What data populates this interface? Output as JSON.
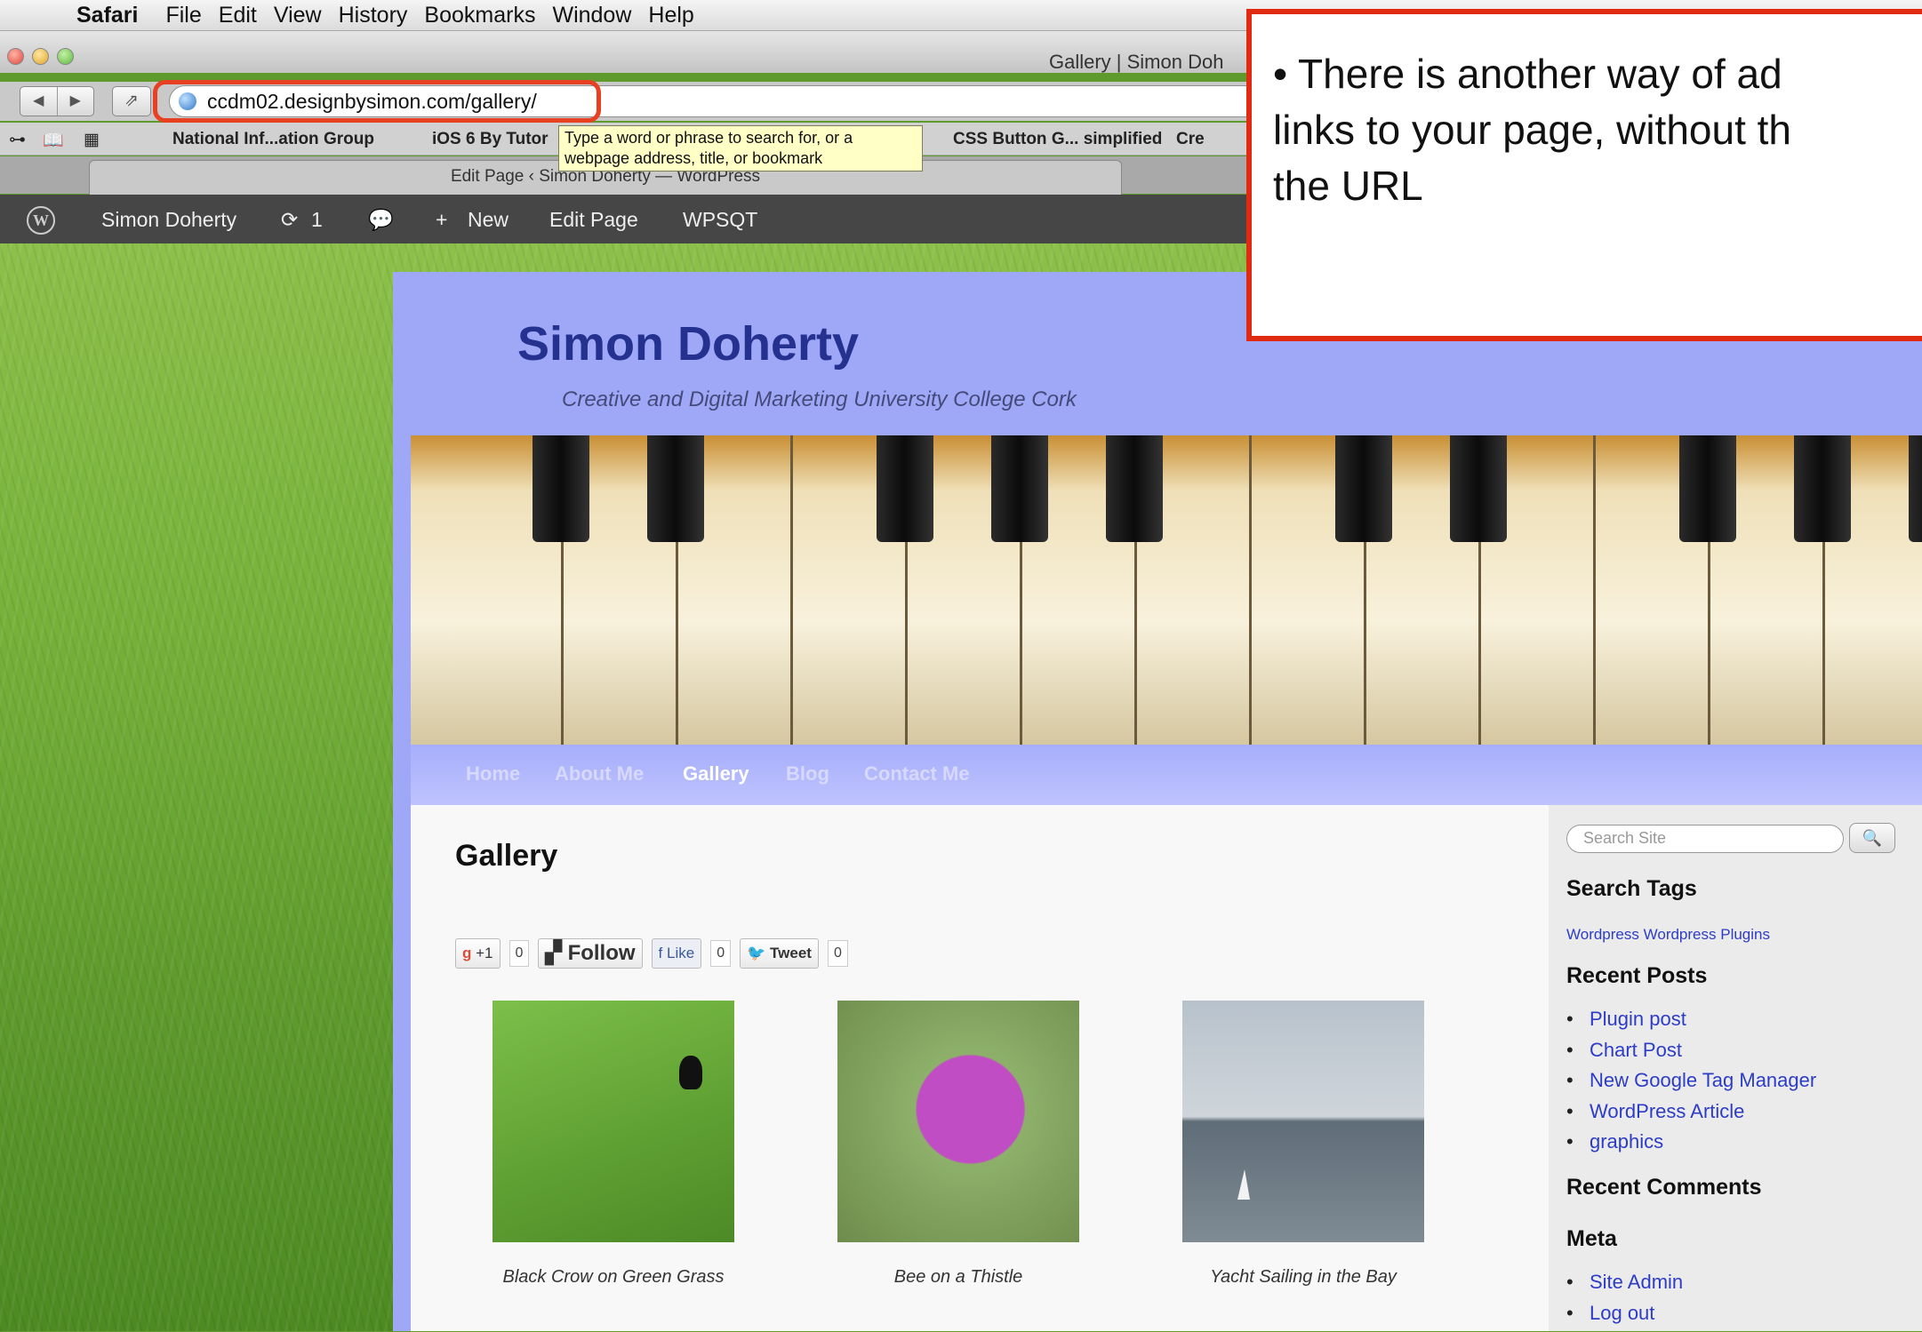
{
  "menubar": {
    "app": "Safari",
    "items": [
      "File",
      "Edit",
      "View",
      "History",
      "Bookmarks",
      "Window",
      "Help"
    ]
  },
  "window": {
    "title": "Gallery | Simon Doh"
  },
  "address": {
    "url": "ccdm02.designbysimon.com/gallery/"
  },
  "bookmarks": {
    "items": [
      "National Inf...ation Group",
      "iOS 6 By Tutor",
      "CSS Button G... simplified",
      "Cre"
    ]
  },
  "tooltip": {
    "text": "Type a word or phrase to search for, or a webpage address, title, or bookmark"
  },
  "tab": {
    "title": "Edit Page ‹ Simon Doherty — WordPress"
  },
  "wpbar": {
    "site": "Simon Doherty",
    "updates": "1",
    "new": "New",
    "edit": "Edit Page",
    "plugin": "WPSQT"
  },
  "site": {
    "title": "Simon Doherty",
    "tagline": "Creative and Digital Marketing University College Cork",
    "nav": [
      "Home",
      "About Me",
      "Gallery",
      "Blog",
      "Contact Me"
    ]
  },
  "page": {
    "heading": "Gallery",
    "social": {
      "gplus": "+1",
      "gplus_count": "0",
      "follow": "Follow",
      "like": "Like",
      "like_count": "0",
      "tweet": "Tweet",
      "tweet_count": "0"
    },
    "gallery": [
      {
        "caption": "Black Crow on Green Grass"
      },
      {
        "caption": "Bee on a Thistle"
      },
      {
        "caption": "Yacht Sailing in the Bay"
      }
    ]
  },
  "sidebar": {
    "search_placeholder": "Search Site",
    "search_tags_heading": "Search Tags",
    "tags": [
      "Wordpress",
      "Wordpress Plugins"
    ],
    "recent_posts_heading": "Recent Posts",
    "recent_posts": [
      "Plugin post",
      "Chart Post",
      "New Google Tag Manager",
      "WordPress Article",
      "graphics"
    ],
    "recent_comments_heading": "Recent Comments",
    "meta_heading": "Meta",
    "meta": [
      "Site Admin",
      "Log out"
    ]
  },
  "callout": {
    "lines": [
      "• There is another way of ad",
      "links to your page, without th",
      "the URL"
    ]
  },
  "colors": {
    "callout_border": "#e02a12",
    "link": "#2d3cc6",
    "site_title": "#25318f",
    "site_bg": "#9fa8f7"
  }
}
